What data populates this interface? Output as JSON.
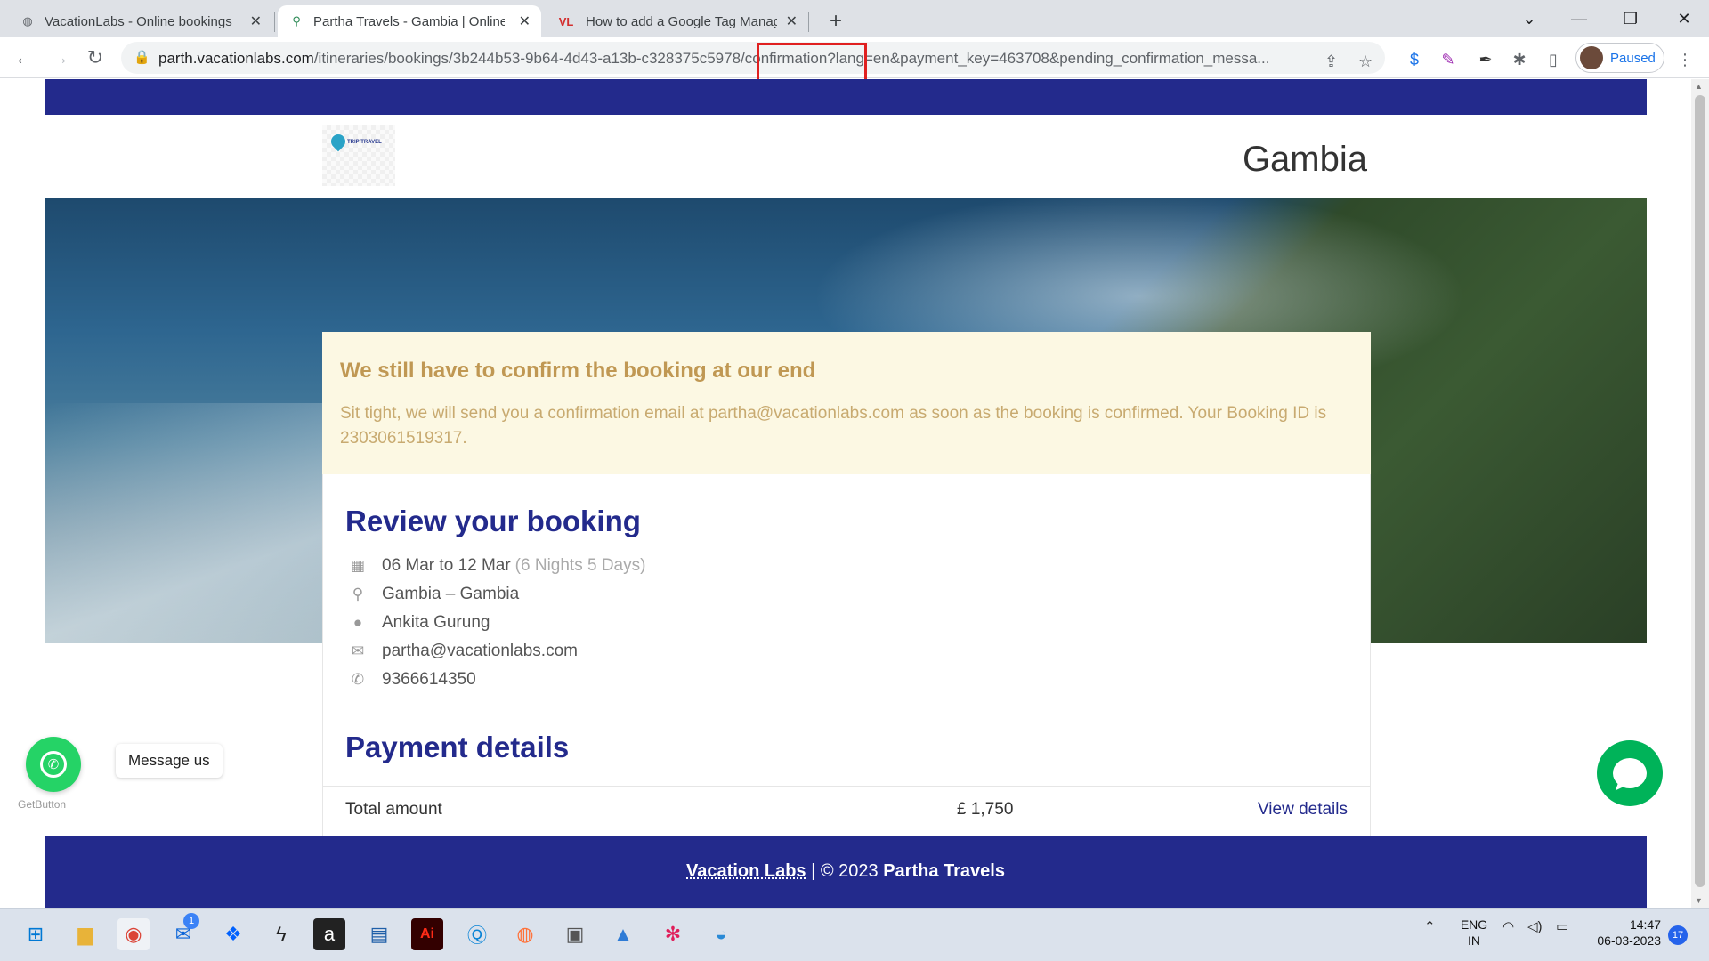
{
  "browser": {
    "tabs": [
      {
        "title": "VacationLabs - Online bookings f",
        "active": false
      },
      {
        "title": "Partha Travels - Gambia | Online B",
        "active": true
      },
      {
        "title": "How to add a Google Tag Manag",
        "active": false
      }
    ],
    "new_tab": "+",
    "url_host": "parth.vacationlabs.com",
    "url_path": "/itineraries/bookings/3b244b53-9b64-4d43-a13b-c328375c5978/confirmation?lang=en&payment_key=463708&pending_confirmation_messa...",
    "profile_status": "Paused"
  },
  "site": {
    "destination": "Gambia",
    "logo_text": "TRIP TRAVEL"
  },
  "alert": {
    "title": "We still have to confirm the booking at our end",
    "message": "Sit tight, we will send you a confirmation email at partha@vacationlabs.com as soon as the booking is confirmed. Your Booking ID is 2303061519317."
  },
  "review": {
    "heading": "Review your booking",
    "dates": "06 Mar to 12 Mar",
    "duration": "(6 Nights 5 Days)",
    "route": "Gambia – Gambia",
    "guest": "Ankita Gurung",
    "email": "partha@vacationlabs.com",
    "phone": "9366614350"
  },
  "payment": {
    "heading": "Payment details",
    "total_label": "Total amount",
    "total_value": "£ 1,750",
    "view_details": "View details"
  },
  "footer": {
    "brand": "Vacation Labs",
    "copyright": " | © 2023 ",
    "company": "Partha Travels"
  },
  "widgets": {
    "message_us": "Message us",
    "getbutton": "GetButton"
  },
  "taskbar": {
    "mail_badge": "1",
    "lang_line1": "ENG",
    "lang_line2": "IN",
    "time": "14:47",
    "date": "06-03-2023",
    "notifications": "17"
  }
}
